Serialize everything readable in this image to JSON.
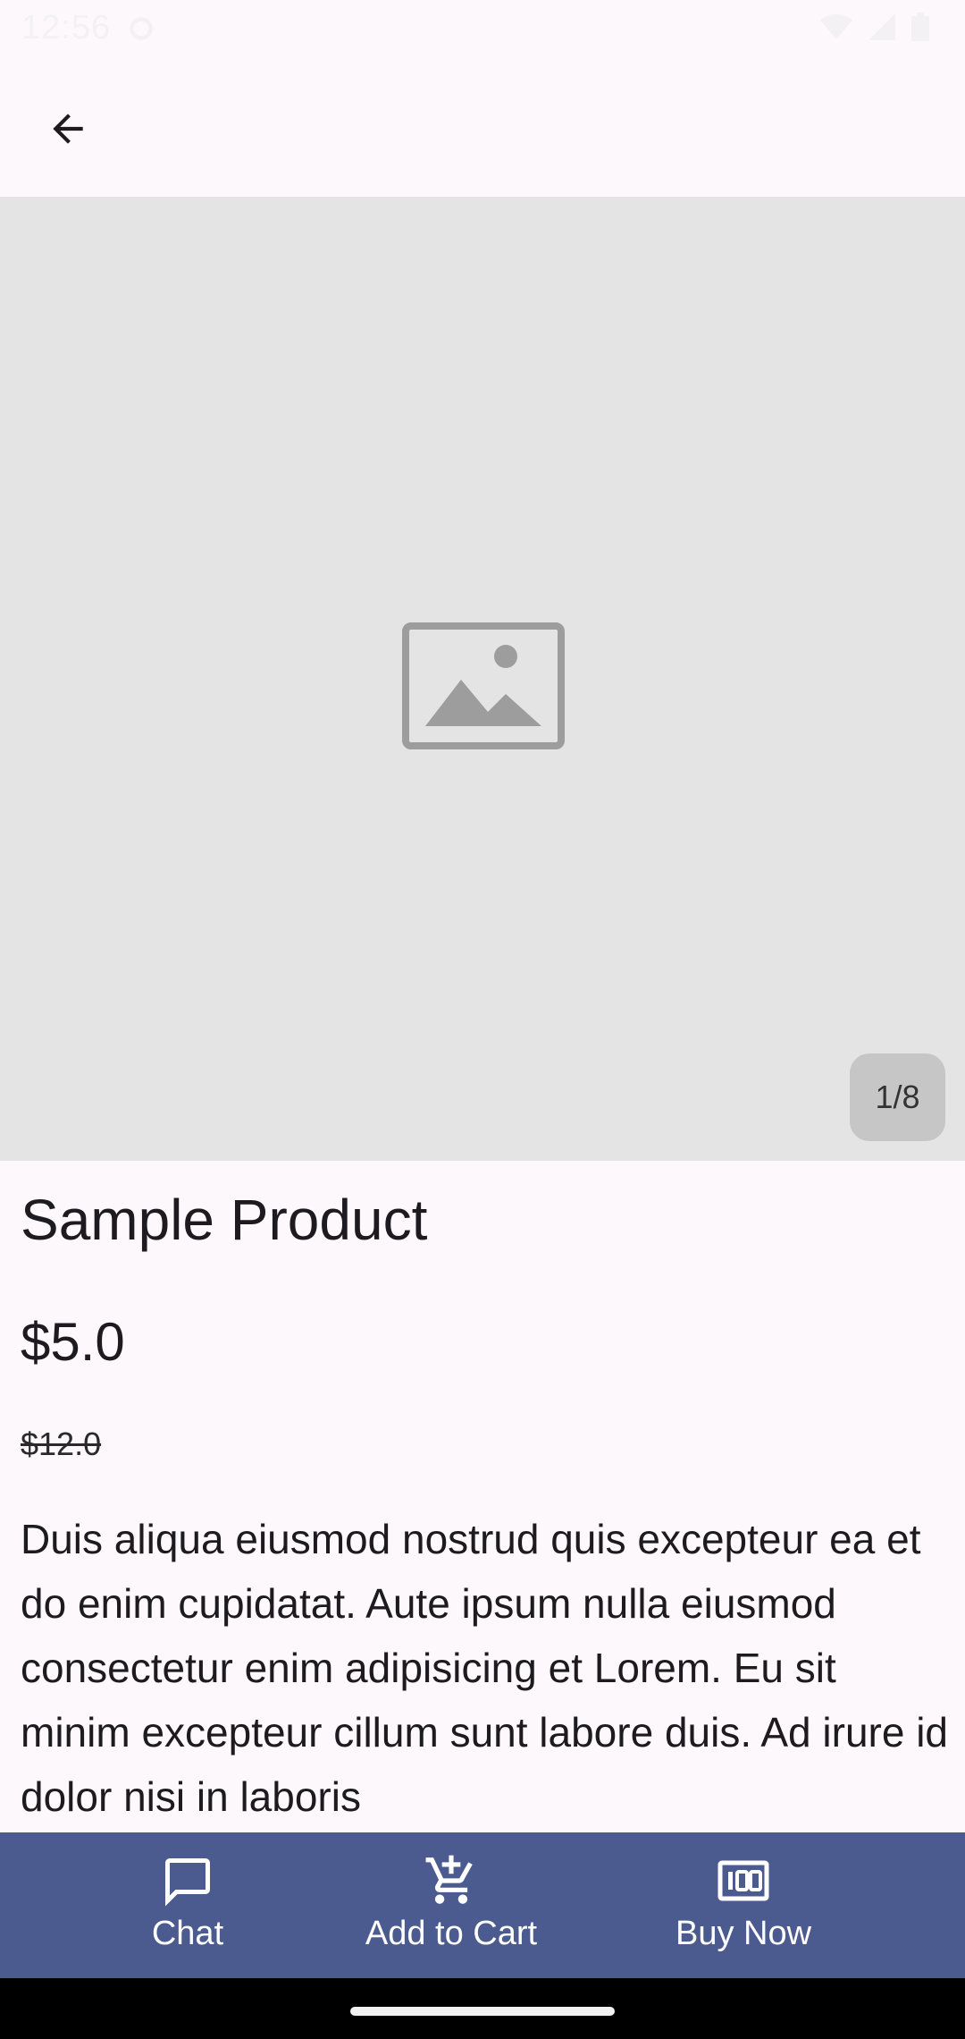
{
  "status_bar": {
    "time": "12:56"
  },
  "app_bar": {
    "back_icon": "arrow-back-icon"
  },
  "gallery": {
    "placeholder_icon": "image-placeholder-icon",
    "counter": "1/8"
  },
  "product": {
    "title": "Sample Product",
    "price": "$5.0",
    "original_price": "$12.0",
    "description": "Duis aliqua eiusmod nostrud quis excepteur ea et do enim cupidatat. Aute ipsum nulla eiusmod consectetur enim adipisicing et Lorem. Eu sit minim excepteur cillum sunt labore duis. Ad irure id dolor nisi in laboris"
  },
  "actions": {
    "chat_label": "Chat",
    "cart_label": "Add to Cart",
    "buy_label": "Buy Now"
  },
  "colors": {
    "background": "#fcf8fb",
    "image_bg": "#e4e4e4",
    "action_bar": "#4b5b8f",
    "text": "#1d1b20"
  }
}
